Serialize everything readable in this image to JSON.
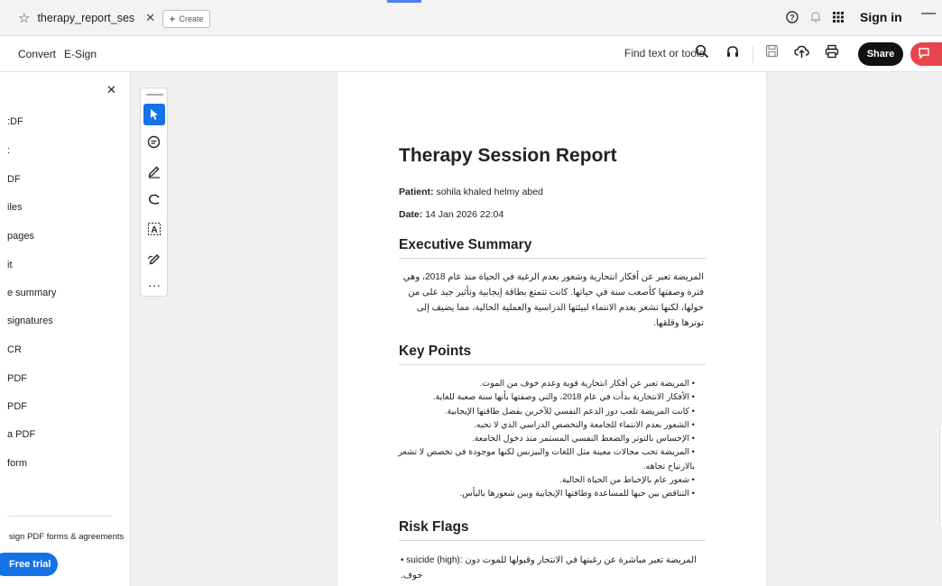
{
  "tabbar": {
    "tab_title": "therapy_report_session...",
    "create_label": "Create",
    "signin_label": "Sign in"
  },
  "toolbar": {
    "menu": [
      "Convert",
      "E-Sign"
    ],
    "find_label": "Find text or tools",
    "share_label": "Share"
  },
  "sidebar": {
    "items": [
      ":DF",
      ":",
      "DF",
      "iles",
      "pages",
      "it",
      "e summary",
      "signatures",
      "CR",
      "PDF",
      "PDF",
      "a PDF",
      "form"
    ],
    "promo": "sign PDF forms & agreements",
    "trial_label": "Free trial"
  },
  "document": {
    "title": "Therapy Session Report",
    "patient_label": "Patient:",
    "patient_value": "sohila khaled helmy abed",
    "date_label": "Date:",
    "date_value": "14 Jan 2026 22:04",
    "sections": {
      "executive_summary": "Executive Summary",
      "key_points": "Key Points",
      "risk_flags": "Risk Flags"
    },
    "executive_summary_text": "المريضة تعبر عن أفكار انتحارية وشعور بعدم الرغبة في الحياة منذ عام 2018، وهي فترة وصفتها كأصعب سنة في حياتها. كانت تتمتع بطاقة إيجابية وتأثير جيد على من حولها، لكنها تشعر بعدم الانتماء لبيئتها الدراسية والعملية الحالية، مما يضيف إلى توترها وقلقها.",
    "key_points": [
      "المريضة تعبر عن أفكار انتحارية قوية وعدم خوف من الموت.",
      "الأفكار الانتحارية بدأت في عام 2018، والتي وصفتها بأنها سنة صعبة للغاية.",
      "كانت المريضة تلعب دور الدعم النفسي للآخرين بفضل طاقتها الإيجابية.",
      "الشعور بعدم الانتماء للجامعة والتخصص الدراسي الذي لا تحبه.",
      "الإحساس بالتوتر والضغط النفسي المستمر منذ دخول الجامعة.",
      "المريضة تحب مجالات معينة مثل اللغات والبيزنس لكنها موجودة في تخصص لا تشعر بالارتياح تجاهه.",
      "شعور عام بالإحباط من الحياة الحالية.",
      "التناقض بين حبها للمساعدة وطاقتها الإيجابية وبين شعورها باليأس."
    ],
    "risk_flag_label": "suicide (high):",
    "risk_flag_text": "المريضة تعبر مباشرة عن رغبتها في الانتحار وقبولها للموت دون خوف."
  }
}
